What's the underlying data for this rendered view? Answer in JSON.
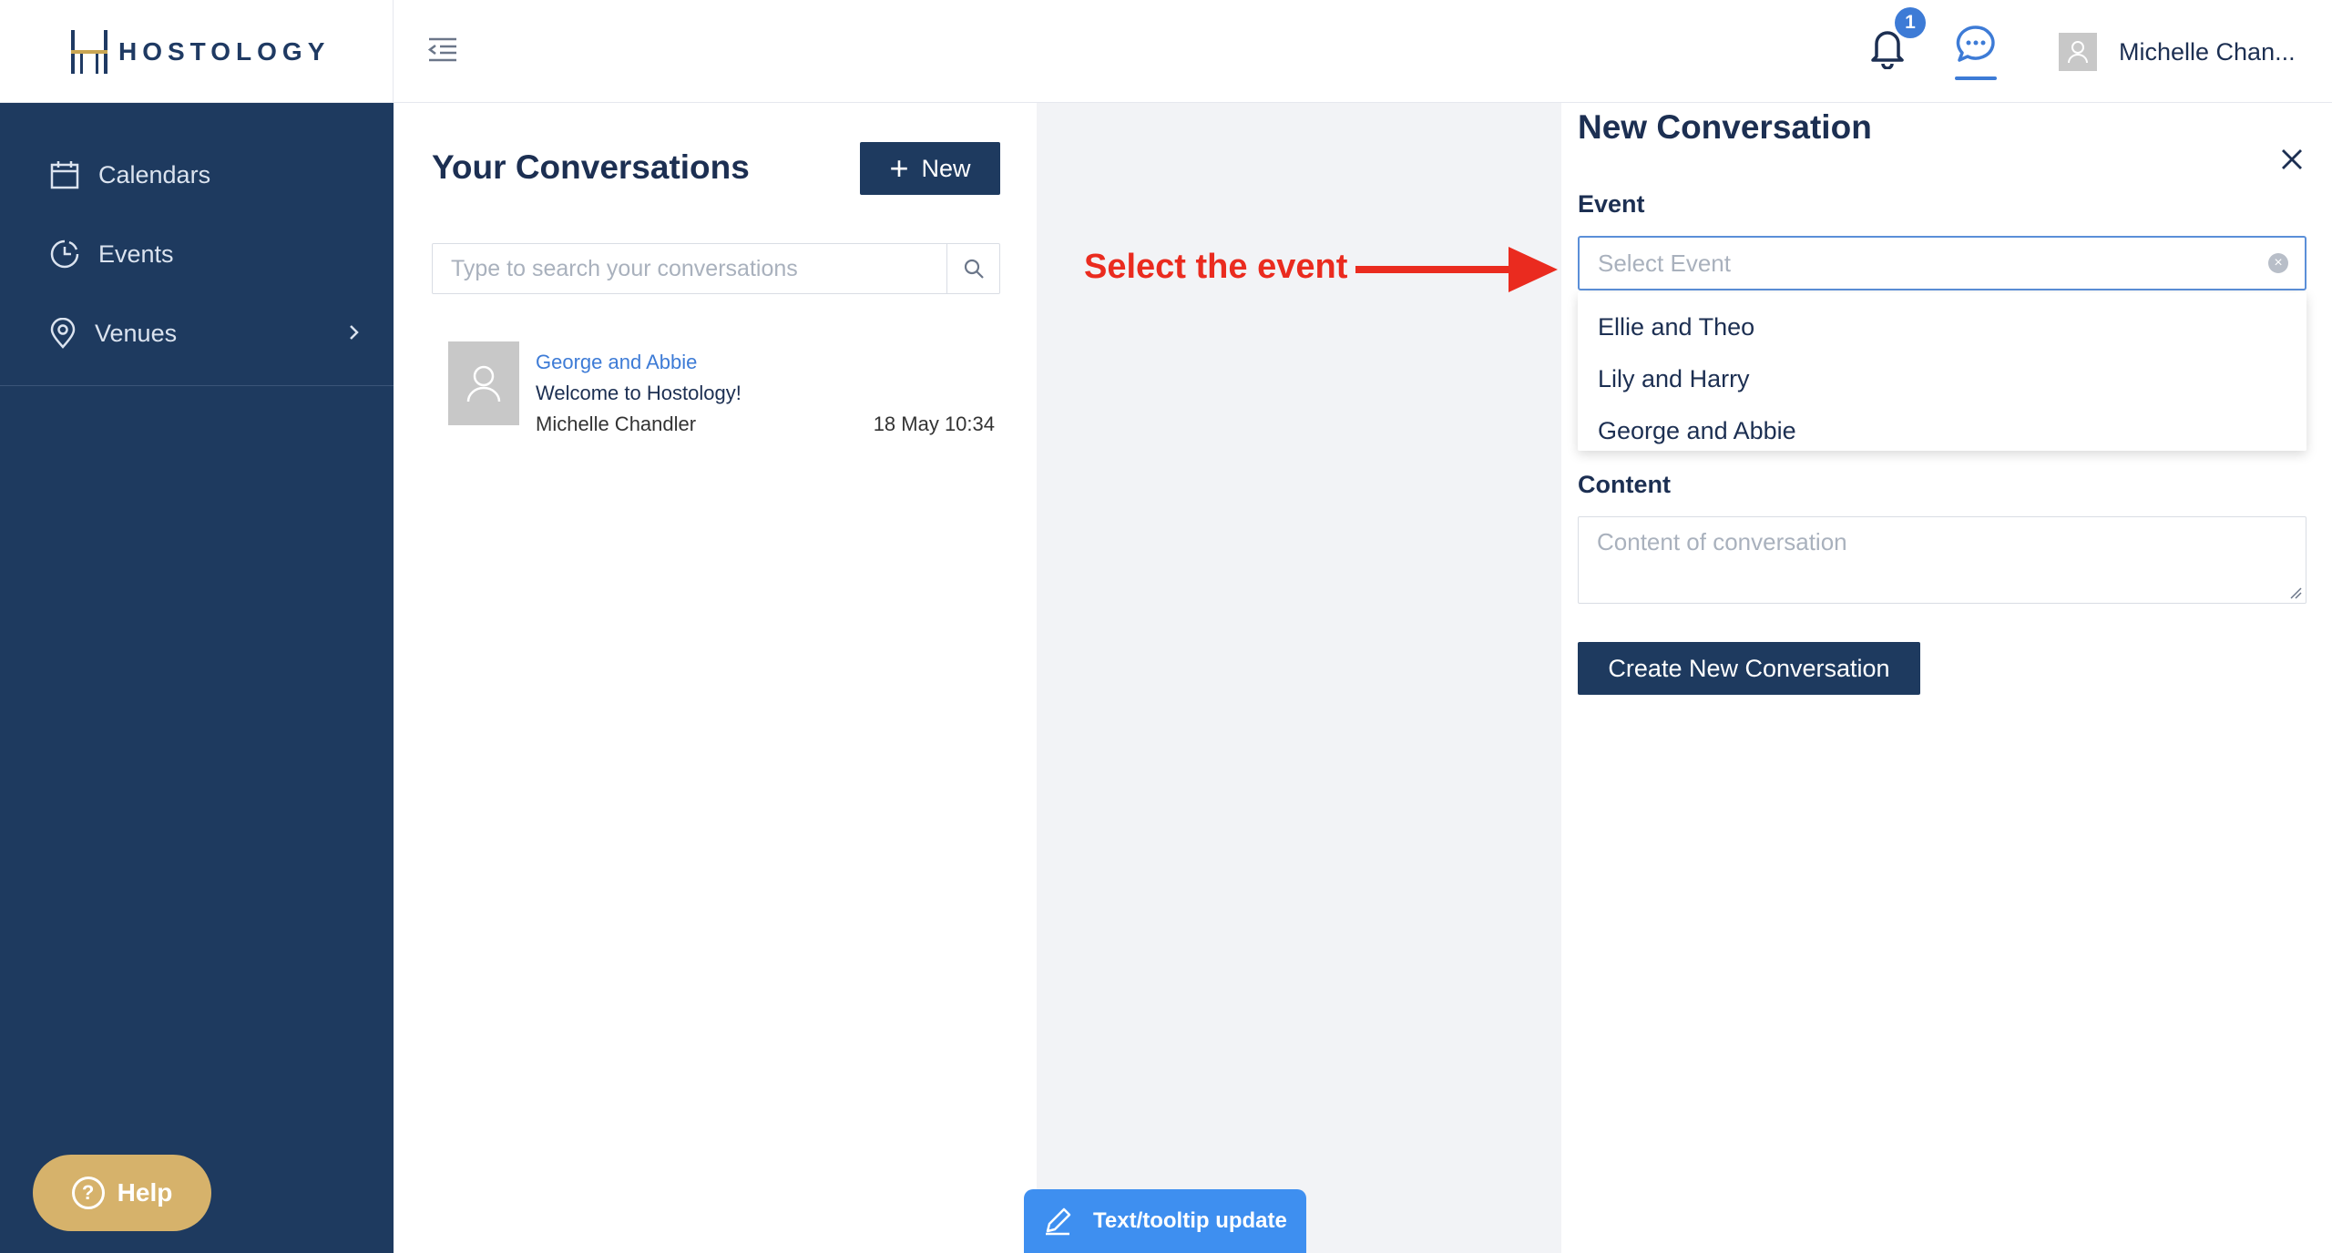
{
  "brand": {
    "name": "HOSTOLOGY"
  },
  "header": {
    "notification_count": "1",
    "user_name": "Michelle Chan..."
  },
  "sidebar": {
    "items": [
      {
        "label": "Calendars",
        "icon": "calendar-icon"
      },
      {
        "label": "Events",
        "icon": "events-icon"
      },
      {
        "label": "Venues",
        "icon": "location-pin-icon"
      }
    ],
    "help_label": "Help"
  },
  "conversations": {
    "title": "Your Conversations",
    "new_button_label": "New",
    "search_placeholder": "Type to search your conversations",
    "items": [
      {
        "event": "George and Abbie",
        "message": "Welcome to Hostology!",
        "sender": "Michelle Chandler",
        "time": "18 May 10:34"
      }
    ]
  },
  "annotation": {
    "text": "Select the event"
  },
  "new_conversation": {
    "title": "New Conversation",
    "event_label": "Event",
    "select_placeholder": "Select Event",
    "options": [
      "Ellie and Theo",
      "Lily and Harry",
      "George and Abbie"
    ],
    "content_label": "Content",
    "content_placeholder": "Content of conversation",
    "create_button_label": "Create New Conversation"
  },
  "floating": {
    "tooltip_update_label": "Text/tooltip update"
  },
  "colors": {
    "sidebar_bg": "#1e3a5f",
    "primary_button": "#1e3a5f",
    "accent_blue": "#3d7bd6",
    "help_gold": "#d6b26b",
    "annotation_red": "#ea2b1f"
  }
}
